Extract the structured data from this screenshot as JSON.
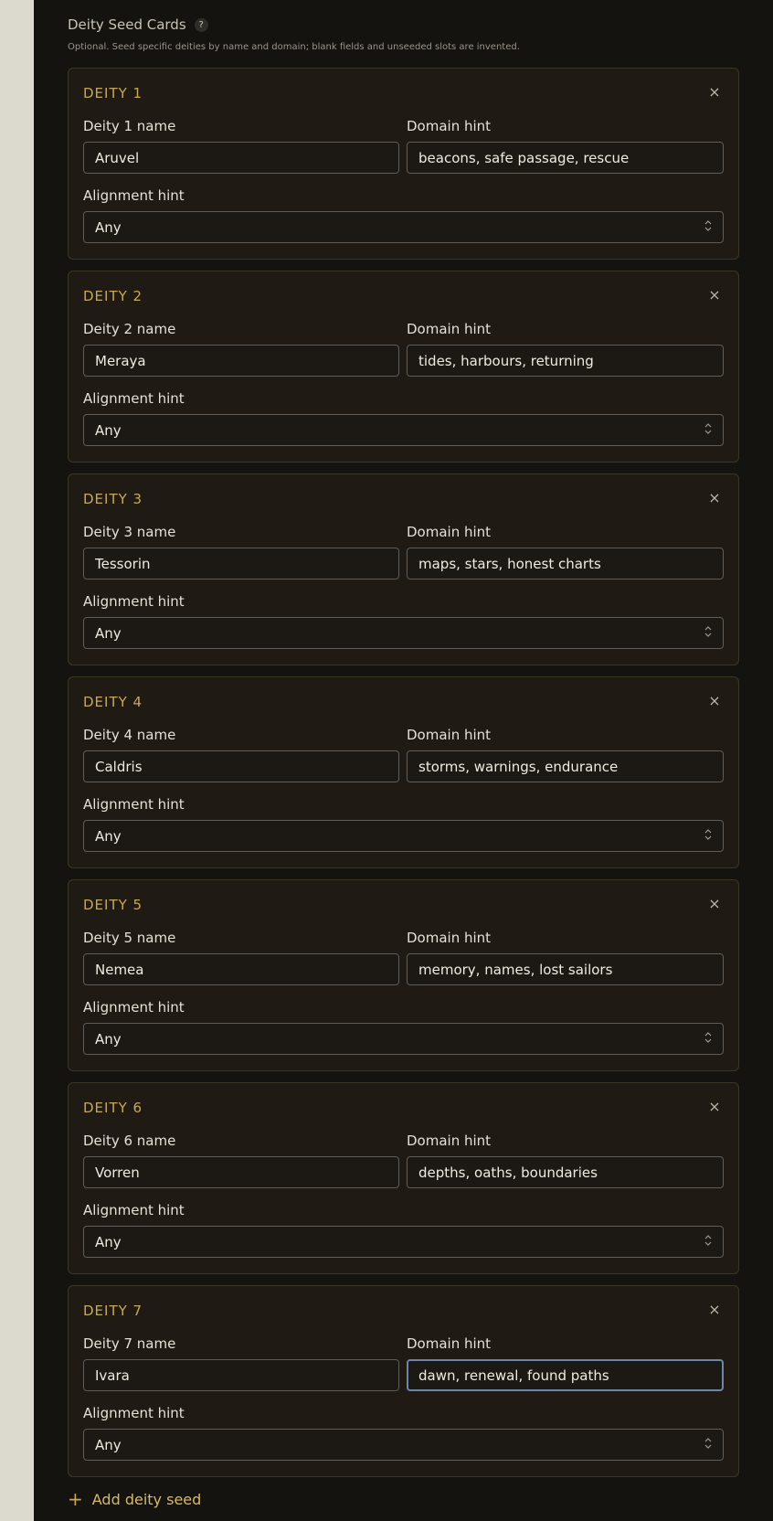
{
  "section": {
    "title": "Deity Seed Cards",
    "help_glyph": "?",
    "description": "Optional. Seed specific deities by name and domain; blank fields and unseeded slots are invented."
  },
  "labels": {
    "domain": "Domain hint",
    "alignment": "Alignment hint",
    "close_glyph": "×",
    "select_chevron": "⌃⌄"
  },
  "cards": [
    {
      "title": "DEITY 1",
      "name_label": "Deity 1 name",
      "name": "Aruvel",
      "domain": "beacons, safe passage, rescue",
      "alignment": "Any"
    },
    {
      "title": "DEITY 2",
      "name_label": "Deity 2 name",
      "name": "Meraya",
      "domain": "tides, harbours, returning",
      "alignment": "Any"
    },
    {
      "title": "DEITY 3",
      "name_label": "Deity 3 name",
      "name": "Tessorin",
      "domain": "maps, stars, honest charts",
      "alignment": "Any"
    },
    {
      "title": "DEITY 4",
      "name_label": "Deity 4 name",
      "name": "Caldris",
      "domain": "storms, warnings, endurance",
      "alignment": "Any"
    },
    {
      "title": "DEITY 5",
      "name_label": "Deity 5 name",
      "name": "Nemea",
      "domain": "memory, names, lost sailors",
      "alignment": "Any"
    },
    {
      "title": "DEITY 6",
      "name_label": "Deity 6 name",
      "name": "Vorren",
      "domain": "depths, oaths, boundaries",
      "alignment": "Any"
    },
    {
      "title": "DEITY 7",
      "name_label": "Deity 7 name",
      "name": "Ivara",
      "domain": "dawn, renewal, found paths",
      "alignment": "Any"
    }
  ],
  "add_button": {
    "icon": "+",
    "label": "Add deity seed"
  },
  "colors": {
    "accent": "#c8a85a",
    "panel_bg": "#141310",
    "card_bg": "#1f1b14",
    "focus_border": "#6d86a8"
  }
}
